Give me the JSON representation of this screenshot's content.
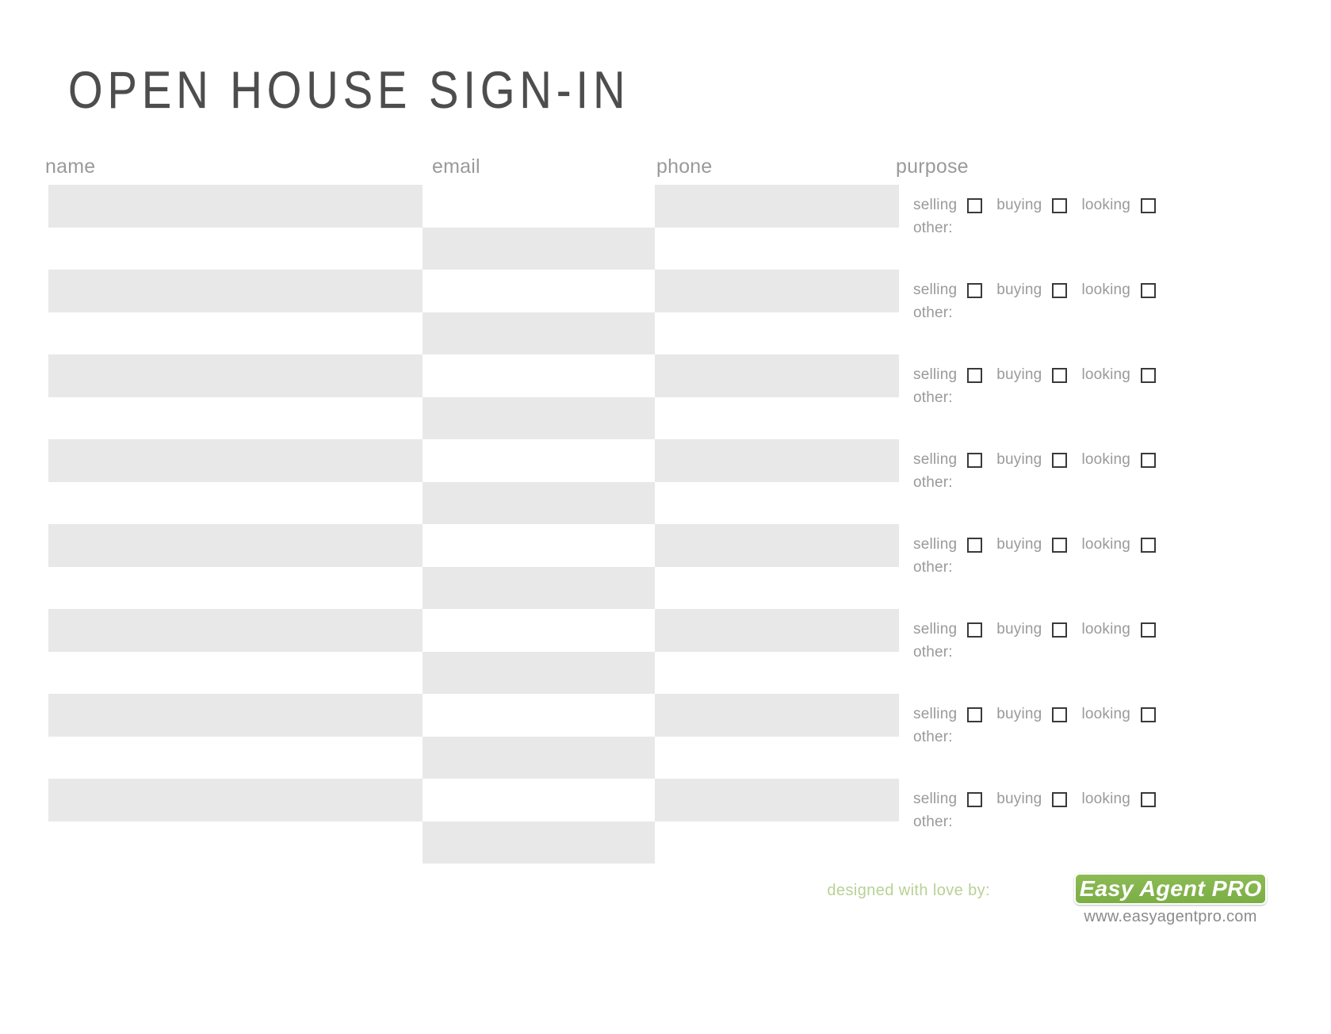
{
  "document": {
    "title": "OPEN HOUSE SIGN-IN"
  },
  "columns": {
    "name": "name",
    "email": "email",
    "phone": "phone",
    "purpose": "purpose"
  },
  "purpose_options": [
    {
      "label": "selling",
      "checked": false
    },
    {
      "label": "buying",
      "checked": false
    },
    {
      "label": "looking",
      "checked": false
    }
  ],
  "purpose_other_label": "other:",
  "row_count": 16,
  "rows": [
    {
      "name": "",
      "email": "",
      "phone": "",
      "other": ""
    },
    {
      "name": "",
      "email": "",
      "phone": "",
      "other": ""
    },
    {
      "name": "",
      "email": "",
      "phone": "",
      "other": ""
    },
    {
      "name": "",
      "email": "",
      "phone": "",
      "other": ""
    },
    {
      "name": "",
      "email": "",
      "phone": "",
      "other": ""
    },
    {
      "name": "",
      "email": "",
      "phone": "",
      "other": ""
    },
    {
      "name": "",
      "email": "",
      "phone": "",
      "other": ""
    },
    {
      "name": "",
      "email": "",
      "phone": "",
      "other": ""
    },
    {
      "name": "",
      "email": "",
      "phone": "",
      "other": ""
    },
    {
      "name": "",
      "email": "",
      "phone": "",
      "other": ""
    },
    {
      "name": "",
      "email": "",
      "phone": "",
      "other": ""
    },
    {
      "name": "",
      "email": "",
      "phone": "",
      "other": ""
    },
    {
      "name": "",
      "email": "",
      "phone": "",
      "other": ""
    },
    {
      "name": "",
      "email": "",
      "phone": "",
      "other": ""
    },
    {
      "name": "",
      "email": "",
      "phone": "",
      "other": ""
    },
    {
      "name": "",
      "email": "",
      "phone": "",
      "other": ""
    }
  ],
  "footer": {
    "credit": "designed with love by:",
    "logo_text": "Easy Agent PRO",
    "url": "www.easyagentpro.com"
  },
  "colors": {
    "shade": "#e8e8e8",
    "brand_green": "#83b44e",
    "credit_green": "#b8d195",
    "text_gray": "#9a9a9a",
    "title_gray": "#4d4d4d"
  }
}
